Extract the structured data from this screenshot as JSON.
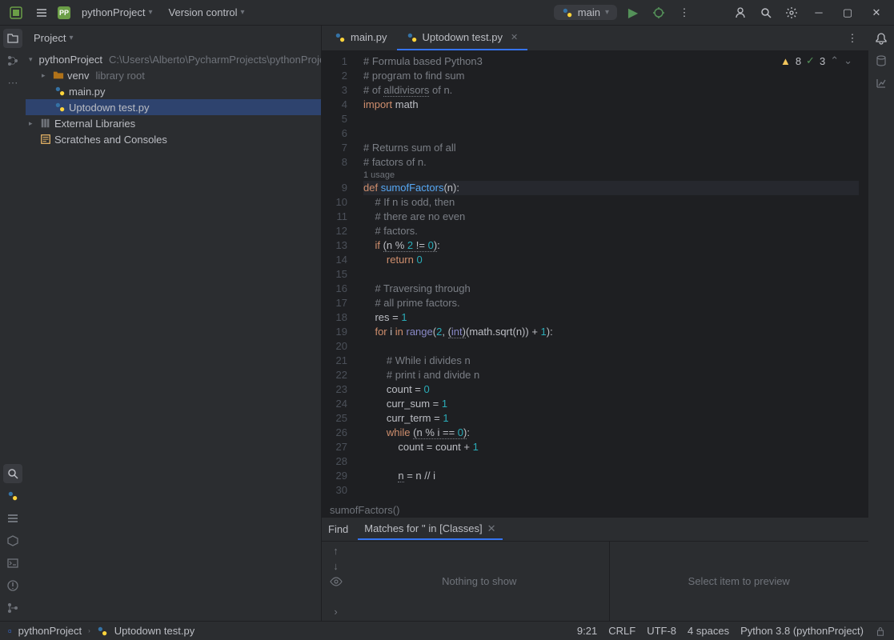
{
  "topbar": {
    "project_name": "pythonProject",
    "vcs_label": "Version control",
    "run_config": "main"
  },
  "project_panel": {
    "title": "Project"
  },
  "tree": {
    "root": "pythonProject",
    "root_hint": "C:\\Users\\Alberto\\PycharmProjects\\pythonProject",
    "venv": "venv",
    "venv_hint": "library root",
    "file_main": "main.py",
    "file_uptodown": "Uptodown test.py",
    "external": "External Libraries",
    "scratches": "Scratches and Consoles"
  },
  "tabs": {
    "main": "main.py",
    "uptodown": "Uptodown test.py"
  },
  "inspections": {
    "warn_count": "8",
    "ok_count": "3"
  },
  "code_lines": [
    {
      "n": "1",
      "html": "<span class='comment'># Formula based Python3</span>"
    },
    {
      "n": "2",
      "html": "<span class='comment'># program to find sum</span>"
    },
    {
      "n": "3",
      "html": "<span class='comment'># of <span class='underline'>alldivisors</span> of n.</span>"
    },
    {
      "n": "4",
      "html": "<span class='keyword'>import</span> math"
    },
    {
      "n": "5",
      "html": ""
    },
    {
      "n": "6",
      "html": ""
    },
    {
      "n": "7",
      "html": "<span class='comment'># Returns sum of all</span>"
    },
    {
      "n": "8",
      "html": "<span class='comment'># factors of n.</span>"
    },
    {
      "n": "",
      "html": "<span class='usage-hint'>1 usage</span>",
      "usage": true
    },
    {
      "n": "9",
      "html": "<span class='keyword'>def</span> <span class='func-def'>sumofFactors</span>(n):",
      "hl": true
    },
    {
      "n": "10",
      "html": "    <span class='comment'># If n is odd, then</span>"
    },
    {
      "n": "11",
      "html": "    <span class='comment'># there are no even</span>"
    },
    {
      "n": "12",
      "html": "    <span class='comment'># factors.</span>"
    },
    {
      "n": "13",
      "html": "    <span class='keyword'>if</span> <span class='underline'>(n % <span class='number'>2</span> != <span class='number'>0</span>)</span>:"
    },
    {
      "n": "14",
      "html": "        <span class='keyword'>return</span> <span class='number'>0</span>"
    },
    {
      "n": "15",
      "html": ""
    },
    {
      "n": "16",
      "html": "    <span class='comment'># Traversing through</span>"
    },
    {
      "n": "17",
      "html": "    <span class='comment'># all prime factors.</span>"
    },
    {
      "n": "18",
      "html": "    res = <span class='number'>1</span>"
    },
    {
      "n": "19",
      "html": "    <span class='keyword'>for</span> i <span class='keyword'>in</span> <span class='builtin'>range</span>(<span class='number'>2</span>, <span class='underline'>(<span class='builtin'>int</span>)</span>(math.sqrt(n)) + <span class='number'>1</span>):"
    },
    {
      "n": "20",
      "html": ""
    },
    {
      "n": "21",
      "html": "        <span class='comment'># While i divides n</span>"
    },
    {
      "n": "22",
      "html": "        <span class='comment'># print i and divide n</span>"
    },
    {
      "n": "23",
      "html": "        count = <span class='number'>0</span>"
    },
    {
      "n": "24",
      "html": "        curr_sum = <span class='number'>1</span>"
    },
    {
      "n": "25",
      "html": "        curr_term = <span class='number'>1</span>"
    },
    {
      "n": "26",
      "html": "        <span class='keyword'>while</span> <span class='underline'>(n % i == <span class='number'>0</span>)</span>:"
    },
    {
      "n": "27",
      "html": "            count = count + <span class='number'>1</span>"
    },
    {
      "n": "28",
      "html": ""
    },
    {
      "n": "29",
      "html": "            <span class='underline'>n</span> = n // i"
    },
    {
      "n": "30",
      "html": ""
    }
  ],
  "breadcrumb_fn": "sumofFactors()",
  "find": {
    "tab": "Find",
    "subtab": "Matches for '' in [Classes]",
    "nothing": "Nothing to show",
    "preview": "Select item to preview"
  },
  "statusbar": {
    "project": "pythonProject",
    "file": "Uptodown test.py",
    "pos": "9:21",
    "sep": "CRLF",
    "enc": "UTF-8",
    "indent": "4 spaces",
    "interpreter": "Python 3.8 (pythonProject)"
  }
}
